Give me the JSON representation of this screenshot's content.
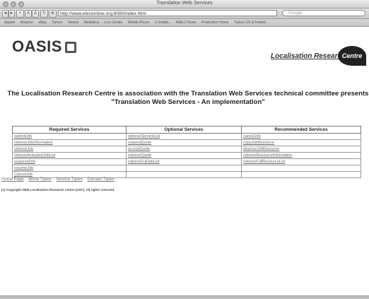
{
  "window": {
    "title": "Translation Web Services"
  },
  "toolbar": {
    "back": "◄",
    "forward": "►",
    "add": "+",
    "text_small": "A",
    "text_large": "A",
    "reload": "↻",
    "stop": "⊗",
    "url": "http://www.electonline.org:8080/index.html",
    "search_placeholder": "Google"
  },
  "bookmarks": [
    "Apple▾",
    "Amazon",
    "eBay",
    "Yahoo!",
    "News▾",
    "Mediatica",
    "Lrco Centre",
    "Mobile Phone",
    "d Vodafo..",
    "Adfa L'Home",
    "Production Home",
    "Yahoo! UK & Ireland"
  ],
  "page": {
    "logo_text": "OASIS",
    "lrc_text": "Localisation Research",
    "lrc_centre": "Centre",
    "heading": "The Localisation Research Centre is association with the Translation Web Services technical committee presents \"Translation Web Services - An implementation\"",
    "table": {
      "headers": [
        "Required Services",
        "Optional Services",
        "Recommended Services"
      ],
      "rows": [
        [
          "submitJob",
          "retrieveServiceList",
          "cancelJob"
        ],
        [
          "retrieveJobInformation",
          "requestQuote",
          "copyJobResource"
        ],
        [
          "retrieveJob",
          "acceptQuote",
          "disposeJobResource"
        ],
        [
          "retrieveActivatedJobList",
          "retrieveQuote",
          "retrieveResourceInformation"
        ],
        [
          "suspendJob",
          "retrieveFullJobList",
          "retrieveFullResourceList"
        ],
        [
          "resumeJob",
          "",
          ""
        ],
        [
          "CancelJob",
          "",
          ""
        ]
      ]
    },
    "nav": [
      "Home Page",
      "Mime Types",
      "Service Types",
      "Domain Types"
    ],
    "copyright": "(c) Copyright 2005 Localisation Research Centre (LRC). All rights reserved."
  }
}
